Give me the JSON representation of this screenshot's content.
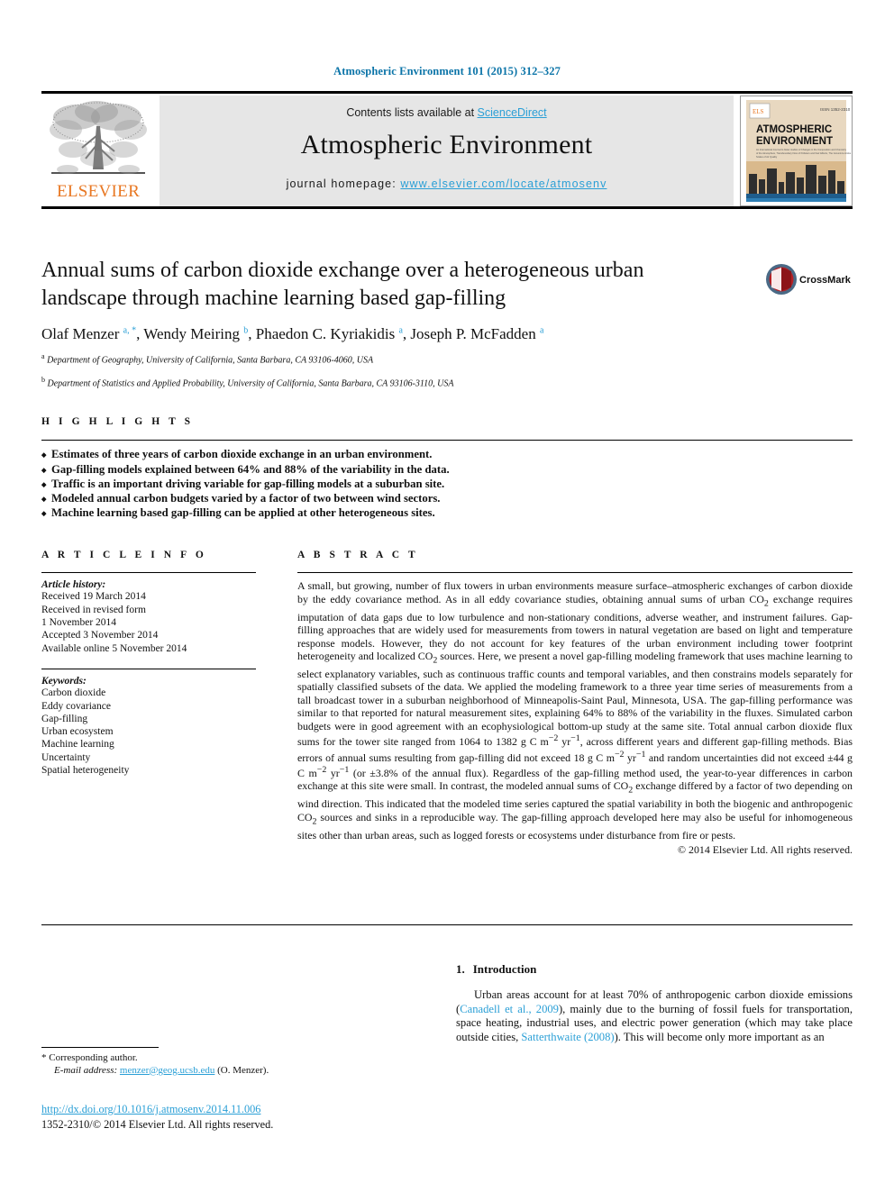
{
  "running_head": "Atmospheric Environment 101 (2015) 312–327",
  "masthead": {
    "contents_prefix": "Contents lists available at ",
    "sciencedirect": "ScienceDirect",
    "journal_name": "Atmospheric Environment",
    "homepage_prefix": "journal homepage: ",
    "homepage_url": "www.elsevier.com/locate/atmosenv",
    "publisher_logo_text": "ELSEVIER",
    "cover_title_line1": "ATMOSPHERIC",
    "cover_title_line2": "ENVIRONMENT"
  },
  "article": {
    "title": "Annual sums of carbon dioxide exchange over a heterogeneous urban landscape through machine learning based gap-filling",
    "authors_html": "Olaf Menzer <sup>a, *</sup>, Wendy Meiring <sup>b</sup>, Phaedon C. Kyriakidis <sup>a</sup>, Joseph P. McFadden <sup>a</sup>",
    "affiliation_a": "Department of Geography, University of California, Santa Barbara, CA 93106-4060, USA",
    "affiliation_b": "Department of Statistics and Applied Probability, University of California, Santa Barbara, CA 93106-3110, USA",
    "crossmark_label": "CrossMark"
  },
  "highlights": {
    "heading": "H I G H L I G H T S",
    "items": [
      "Estimates of three years of carbon dioxide exchange in an urban environment.",
      "Gap-filling models explained between 64% and 88% of the variability in the data.",
      "Traffic is an important driving variable for gap-filling models at a suburban site.",
      "Modeled annual carbon budgets varied by a factor of two between wind sectors.",
      "Machine learning based gap-filling can be applied at other heterogeneous sites."
    ]
  },
  "article_info": {
    "heading": "A R T I C L E   I N F O",
    "history_label": "Article history:",
    "history_lines": [
      "Received 19 March 2014",
      "Received in revised form",
      "1 November 2014",
      "Accepted 3 November 2014",
      "Available online 5 November 2014"
    ],
    "keywords_label": "Keywords:",
    "keywords": [
      "Carbon dioxide",
      "Eddy covariance",
      "Gap-filling",
      "Urban ecosystem",
      "Machine learning",
      "Uncertainty",
      "Spatial heterogeneity"
    ]
  },
  "abstract": {
    "heading": "A B S T R A C T",
    "body_html": "A small, but growing, number of flux towers in urban environments measure surface–atmospheric exchanges of carbon dioxide by the eddy covariance method. As in all eddy covariance studies, obtaining annual sums of urban CO<sub>2</sub> exchange requires imputation of data gaps due to low turbulence and non-stationary conditions, adverse weather, and instrument failures. Gap-filling approaches that are widely used for measurements from towers in natural vegetation are based on light and temperature response models. However, they do not account for key features of the urban environment including tower footprint heterogeneity and localized CO<sub>2</sub> sources. Here, we present a novel gap-filling modeling framework that uses machine learning to select explanatory variables, such as continuous traffic counts and temporal variables, and then constrains models separately for spatially classified subsets of the data. We applied the modeling framework to a three year time series of measurements from a tall broadcast tower in a suburban neighborhood of Minneapolis-Saint Paul, Minnesota, USA. The gap-filling performance was similar to that reported for natural measurement sites, explaining 64% to 88% of the variability in the fluxes. Simulated carbon budgets were in good agreement with an ecophysiological bottom-up study at the same site. Total annual carbon dioxide flux sums for the tower site ranged from 1064 to 1382 g C m<sup>−2</sup> yr<sup>−1</sup>, across different years and different gap-filling methods. Bias errors of annual sums resulting from gap-filling did not exceed 18 g C m<sup>−2</sup> yr<sup>−1</sup> and random uncertainties did not exceed ±44 g C m<sup>−2</sup> yr<sup>−1</sup> (or ±3.8% of the annual flux). Regardless of the gap-filling method used, the year-to-year differences in carbon exchange at this site were small. In contrast, the modeled annual sums of CO<sub>2</sub> exchange differed by a factor of two depending on wind direction. This indicated that the modeled time series captured the spatial variability in both the biogenic and anthropogenic CO<sub>2</sub> sources and sinks in a reproducible way. The gap-filling approach developed here may also be useful for inhomogeneous sites other than urban areas, such as logged forests or ecosystems under disturbance from fire or pests.",
    "copyright": "© 2014 Elsevier Ltd. All rights reserved."
  },
  "introduction": {
    "number": "1.",
    "heading": "Introduction",
    "body_html": "Urban areas account for at least 70% of anthropogenic carbon dioxide emissions (<span class=\"ref\">Canadell et al., 2009</span>), mainly due to the burning of fossil fuels for transportation, space heating, industrial uses, and electric power generation (which may take place outside cities, <span class=\"ref\">Satterthwaite (2008)</span>). This will become only more important as an"
  },
  "footnotes": {
    "corresponding": "* Corresponding author.",
    "email_label": "E-mail address:",
    "email": "menzer@geog.ucsb.edu",
    "email_suffix": "(O. Menzer).",
    "doi": "http://dx.doi.org/10.1016/j.atmosenv.2014.11.006",
    "issn_line": "1352-2310/© 2014 Elsevier Ltd. All rights reserved."
  }
}
